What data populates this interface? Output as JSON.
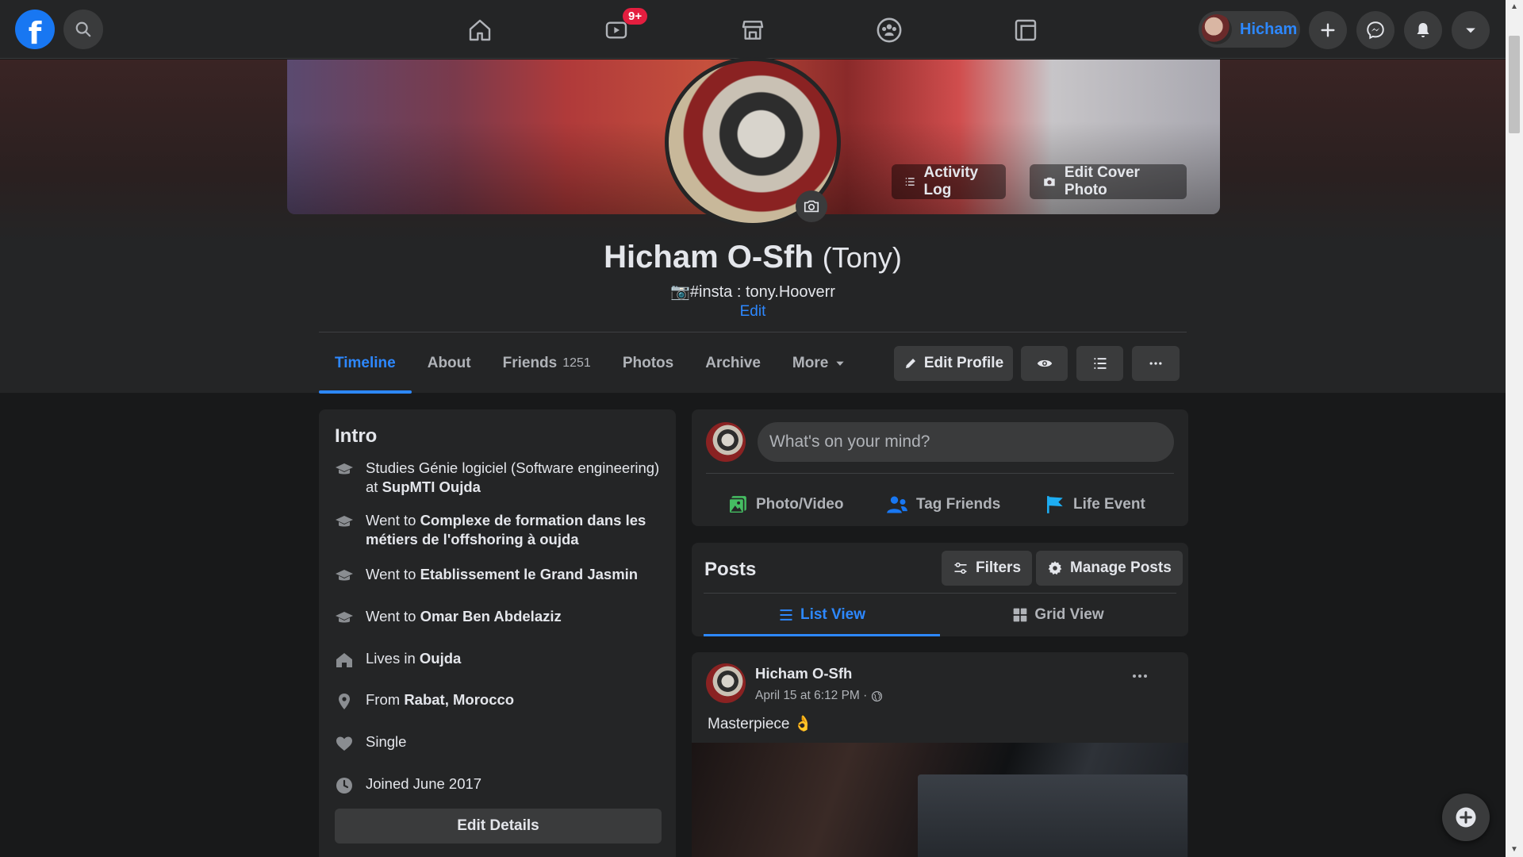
{
  "topbar": {
    "logo_letter": "f",
    "notification_badge": "9+",
    "profile_name": "Hicham"
  },
  "cover": {
    "activity_log_label": "Activity Log",
    "edit_cover_label": "Edit Cover Photo"
  },
  "profile": {
    "name": "Hicham O-Sfh",
    "nickname": "(Tony)",
    "bio": "#insta : tony.Hooverr",
    "bio_edit_label": "Edit"
  },
  "tabs": [
    {
      "label": "Timeline",
      "active": true
    },
    {
      "label": "About"
    },
    {
      "label": "Friends",
      "count": "1251"
    },
    {
      "label": "Photos"
    },
    {
      "label": "Archive"
    },
    {
      "label": "More"
    }
  ],
  "header_actions": {
    "edit_profile_label": "Edit Profile"
  },
  "intro": {
    "title": "Intro",
    "items": [
      {
        "icon": "graduation-cap-icon",
        "prefix": "Studies Génie logiciel (Software engineering) at ",
        "bold": "SupMTI Oujda"
      },
      {
        "icon": "graduation-cap-icon",
        "prefix": "Went to ",
        "bold": "Complexe de formation dans les métiers de l'offshoring à oujda"
      },
      {
        "icon": "graduation-cap-icon",
        "prefix": "Went to ",
        "bold": "Etablissement le Grand Jasmin"
      },
      {
        "icon": "graduation-cap-icon",
        "prefix": "Went to ",
        "bold": "Omar Ben Abdelaziz"
      },
      {
        "icon": "home-icon",
        "prefix": "Lives in ",
        "bold": "Oujda"
      },
      {
        "icon": "location-pin-icon",
        "prefix": "From ",
        "bold": "Rabat, Morocco"
      },
      {
        "icon": "heart-icon",
        "prefix": "Single",
        "bold": ""
      },
      {
        "icon": "clock-icon",
        "prefix": "Joined June 2017",
        "bold": ""
      }
    ],
    "edit_details_label": "Edit Details"
  },
  "composer": {
    "placeholder": "What's on your mind?",
    "photo_video_label": "Photo/Video",
    "tag_friends_label": "Tag Friends",
    "life_event_label": "Life Event"
  },
  "posts": {
    "title": "Posts",
    "filters_label": "Filters",
    "manage_label": "Manage Posts",
    "list_view_label": "List View",
    "grid_view_label": "Grid View"
  },
  "post": {
    "author": "Hicham O-Sfh",
    "meta": "April 15 at 6:12 PM ·",
    "text": "Masterpiece 👌"
  },
  "colors": {
    "accent": "#2d88ff",
    "brand": "#1877f2",
    "badge": "#e41e3f",
    "green": "#45bd62",
    "flag": "#1dadf2"
  }
}
